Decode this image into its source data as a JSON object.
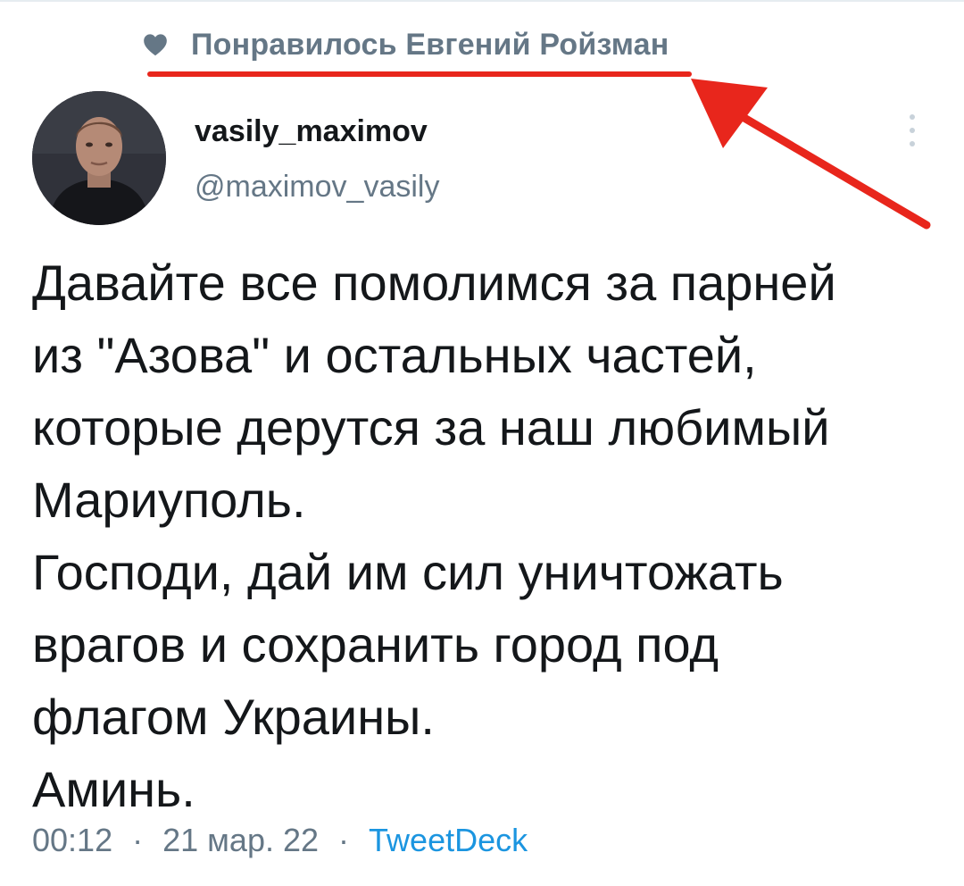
{
  "liked_by": {
    "icon": "heart-icon",
    "text": "Понравилось Евгений Ройзман"
  },
  "author": {
    "display_name": "vasily_maximov",
    "handle": "@maximov_vasily",
    "avatar": "user-avatar-photo"
  },
  "tweet": {
    "lines": [
      "Давайте все помолимся за парней",
      "из \"Азова\" и остальных частей,",
      "которые дерутся за наш любимый",
      "Мариуполь.",
      "Господи, дай им сил уничтожать",
      "врагов и сохранить город под",
      "флагом Украины.",
      "Аминь."
    ]
  },
  "meta": {
    "time": "00:12",
    "separator": "·",
    "date": "21 мар. 22",
    "source": "TweetDeck"
  },
  "colors": {
    "annotation": "#e8261c",
    "secondary_text": "#657786",
    "link": "#1b95e0"
  }
}
